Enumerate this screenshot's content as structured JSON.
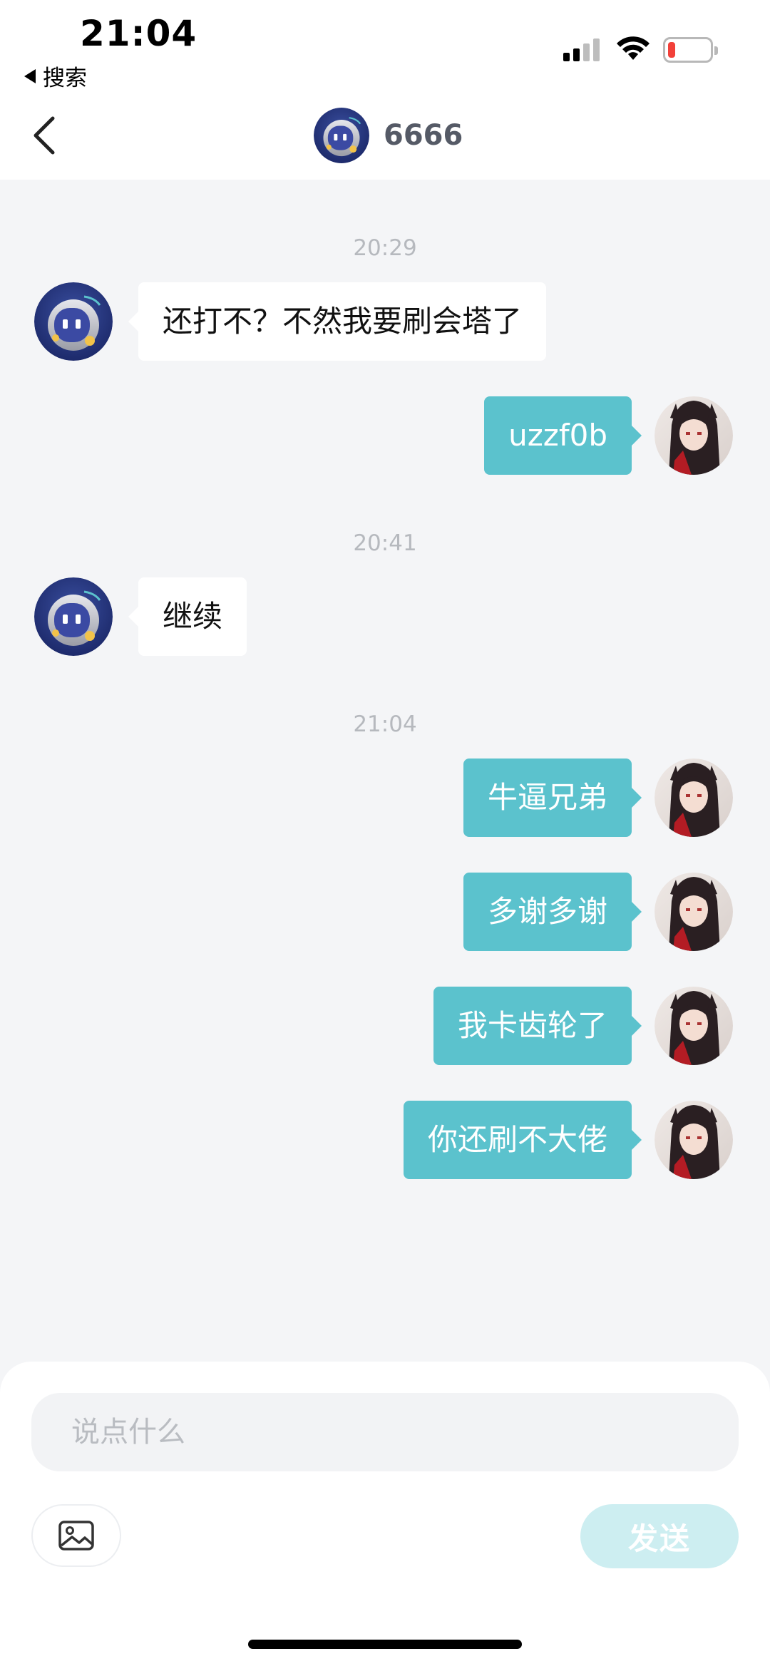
{
  "status_bar": {
    "time": "21:04",
    "back_app_label": "搜索",
    "icons": [
      "signal-icon",
      "wifi-icon",
      "battery-low-icon"
    ]
  },
  "header": {
    "back_icon": "chevron-left-icon",
    "contact_name": "6666",
    "avatar": "robot-avatar"
  },
  "colors": {
    "accent": "#5bc2cd",
    "background": "#f4f5f7",
    "send_disabled": "#cdeef1"
  },
  "messages": [
    {
      "type": "timestamp",
      "text": "20:29"
    },
    {
      "type": "incoming",
      "text": "还打不？不然我要刷会塔了"
    },
    {
      "type": "outgoing",
      "text": "uzzf0b"
    },
    {
      "type": "timestamp",
      "text": "20:41"
    },
    {
      "type": "incoming",
      "text": "继续"
    },
    {
      "type": "timestamp",
      "text": "21:04"
    },
    {
      "type": "outgoing",
      "text": "牛逼兄弟"
    },
    {
      "type": "outgoing",
      "text": "多谢多谢"
    },
    {
      "type": "outgoing",
      "text": "我卡齿轮了"
    },
    {
      "type": "outgoing",
      "text": "你还刷不大佬"
    }
  ],
  "composer": {
    "placeholder": "说点什么",
    "image_icon": "image-icon",
    "send_label": "发送"
  }
}
